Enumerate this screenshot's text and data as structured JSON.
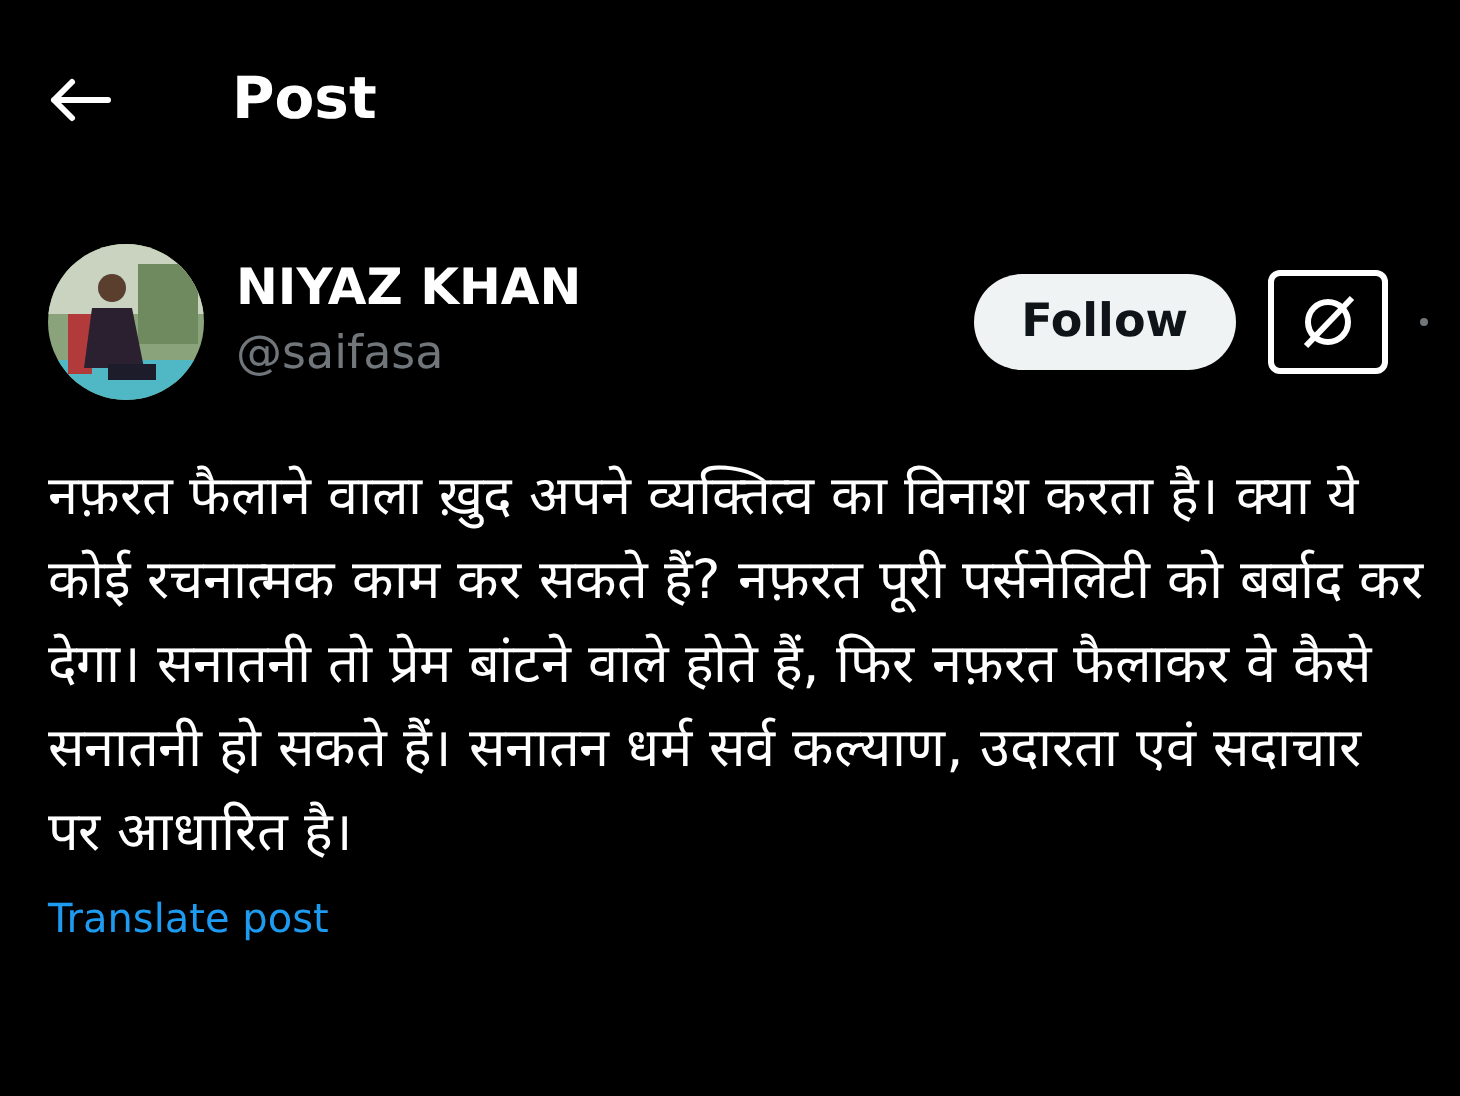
{
  "header": {
    "title": "Post"
  },
  "author": {
    "name": "NIYAZ KHAN",
    "handle": "@saifasa"
  },
  "follow_button": {
    "label": "Follow"
  },
  "post": {
    "text": "नफ़रत फैलाने वाला ख़ुद अपने व्यक्तित्व का विनाश करता है। क्या ये कोई रचनात्मक काम कर सकते हैं? नफ़रत पूरी पर्सनेलिटी को बर्बाद कर देगा। सनातनी तो प्रेम बांटने वाले होते हैं, फिर नफ़रत फैलाकर वे कैसे सनातनी हो सकते हैं। सनातन धर्म सर्व कल्याण, उदारता एवं सदाचार पर आधारित है।",
    "translate_link": "Translate post"
  }
}
